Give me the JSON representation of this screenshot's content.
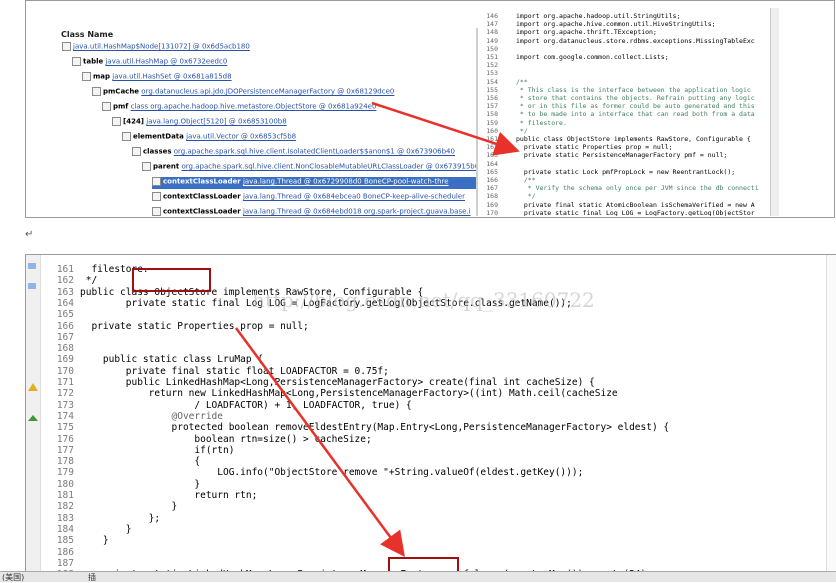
{
  "top": {
    "tree_header": "Class Name",
    "tree_rows": [
      {
        "indent": 0,
        "name": "",
        "value": "java.util.HashMap$Node[131072] @ 0x6d5acb180",
        "sel": false
      },
      {
        "indent": 1,
        "name": "table",
        "value": "java.util.HashMap @ 0x6732eedc0",
        "sel": false
      },
      {
        "indent": 2,
        "name": "map",
        "value": "java.util.HashSet @ 0x681a815d8",
        "sel": false
      },
      {
        "indent": 3,
        "name": "pmCache",
        "value": "org.datanucleus.api.jdo.JDOPersistenceManagerFactory @ 0x68129dce0",
        "sel": false
      },
      {
        "indent": 4,
        "name": "pmf",
        "value": "class org.apache.hadoop.hive.metastore.ObjectStore @ 0x681a924e0",
        "sel": false
      },
      {
        "indent": 5,
        "name": "[424]",
        "value": "java.lang.Object[5120] @ 0x6853100b8",
        "sel": false
      },
      {
        "indent": 6,
        "name": "elementData",
        "value": "java.util.Vector @ 0x6853cf5b8",
        "sel": false
      },
      {
        "indent": 7,
        "name": "classes",
        "value": "org.apache.spark.sql.hive.client.IsolatedClientLoader$$anon$1 @ 0x673906b40",
        "sel": false
      },
      {
        "indent": 8,
        "name": "parent",
        "value": "org.apache.spark.sql.hive.client.NonClosableMutableURLClassLoader @ 0x673915b6",
        "sel": false
      },
      {
        "indent": 9,
        "name": "contextClassLoader",
        "value": "java.lang.Thread @ 0x6729908d0 BoneCP-pool-watch-thre",
        "sel": true
      },
      {
        "indent": 9,
        "name": "contextClassLoader",
        "value": "java.lang.Thread @ 0x684ebcea0 BoneCP-keep-alive-scheduler",
        "sel": false
      },
      {
        "indent": 9,
        "name": "contextClassLoader",
        "value": "java.lang.Thread @ 0x684ebd018 org.spark-project.guava.base.i",
        "sel": false
      }
    ],
    "code_lines": [
      {
        "n": "146",
        "t": "import org.apache.hadoop.util.StringUtils;"
      },
      {
        "n": "147",
        "t": "import org.apache.hive.common.util.HiveStringUtils;"
      },
      {
        "n": "148",
        "t": "import org.apache.thrift.TException;"
      },
      {
        "n": "149",
        "t": "import org.datanucleus.store.rdbms.exceptions.MissingTableExc"
      },
      {
        "n": "150",
        "t": ""
      },
      {
        "n": "151",
        "t": "import com.google.common.collect.Lists;"
      },
      {
        "n": "152",
        "t": ""
      },
      {
        "n": "153",
        "t": ""
      },
      {
        "n": "154",
        "t": "/**"
      },
      {
        "n": "155",
        "t": " * This class is the interface between the application logic"
      },
      {
        "n": "156",
        "t": " * store that contains the objects. Refrain putting any logic"
      },
      {
        "n": "157",
        "t": " * or in this file as former could be auto generated and this"
      },
      {
        "n": "158",
        "t": " * to be made into a interface that can read both from a data"
      },
      {
        "n": "159",
        "t": " * filestore."
      },
      {
        "n": "160",
        "t": " */"
      },
      {
        "n": "161",
        "t": "public class ObjectStore implements RawStore, Configurable {"
      },
      {
        "n": "162",
        "t": "  private static Properties prop = null;"
      },
      {
        "n": "163",
        "t": "  private static PersistenceManagerFactory pmf = null;"
      },
      {
        "n": "164",
        "t": ""
      },
      {
        "n": "165",
        "t": "  private static Lock pmfPropLock = new ReentrantLock();"
      },
      {
        "n": "166",
        "t": "  /**"
      },
      {
        "n": "167",
        "t": "   * Verify the schema only once per JVM since the db connecti"
      },
      {
        "n": "168",
        "t": "   */"
      },
      {
        "n": "169",
        "t": "  private final static AtomicBoolean isSchemaVerified = new A"
      },
      {
        "n": "170",
        "t": "  private static final Log LOG = LogFactory.getLog(ObjectStor"
      }
    ]
  },
  "return_mark": "↵",
  "watermark": "http://blog.csdn.net/qq_33160722",
  "bottom": {
    "lines": [
      {
        "n": "161",
        "t": "  filestore."
      },
      {
        "n": "162",
        "t": " */"
      },
      {
        "n": "163",
        "t": "public class ObjectStore implements RawStore, Configurable {"
      },
      {
        "n": "164",
        "t": "        private static final Log LOG = LogFactory.getLog(ObjectStore.class.getName());"
      },
      {
        "n": "165",
        "t": ""
      },
      {
        "n": "166",
        "t": "  private static Properties prop = null;"
      },
      {
        "n": "167",
        "t": ""
      },
      {
        "n": "168",
        "t": ""
      },
      {
        "n": "169",
        "t": "    public static class LruMap {"
      },
      {
        "n": "170",
        "t": "        private final static float LOADFACTOR = 0.75f;"
      },
      {
        "n": "171",
        "t": "        public LinkedHashMap<Long,PersistenceManagerFactory> create(final int cacheSize) {"
      },
      {
        "n": "172",
        "t": "            return new LinkedHashMap<Long,PersistenceManagerFactory>((int) Math.ceil(cacheSize"
      },
      {
        "n": "173",
        "t": "                    / LOADFACTOR) + 1, LOADFACTOR, true) {"
      },
      {
        "n": "174",
        "t": "                @Override"
      },
      {
        "n": "175",
        "t": "                protected boolean removeEldestEntry(Map.Entry<Long,PersistenceManagerFactory> eldest) {"
      },
      {
        "n": "176",
        "t": "                    boolean rtn=size() > cacheSize;"
      },
      {
        "n": "177",
        "t": "                    if(rtn)"
      },
      {
        "n": "178",
        "t": "                    {"
      },
      {
        "n": "179",
        "t": "                        LOG.info(\"ObjectStore remove \"+String.valueOf(eldest.getKey()));"
      },
      {
        "n": "180",
        "t": "                    }"
      },
      {
        "n": "181",
        "t": "                    return rtn;"
      },
      {
        "n": "182",
        "t": "                }"
      },
      {
        "n": "183",
        "t": "            };"
      },
      {
        "n": "184",
        "t": "        }"
      },
      {
        "n": "185",
        "t": "    }"
      },
      {
        "n": "186",
        "t": ""
      },
      {
        "n": "187",
        "t": ""
      },
      {
        "n": "188",
        "t": "    private static LinkedHashMap<Long,PersistenceManagerFactory> pmf_lazy=(new LruMap()).create(24);"
      }
    ]
  },
  "status": {
    "left": "(美国)",
    "mid": "插"
  },
  "colors": {
    "arrow": "#e8312a",
    "box": "#a01010",
    "selection": "#3a6fc4"
  }
}
